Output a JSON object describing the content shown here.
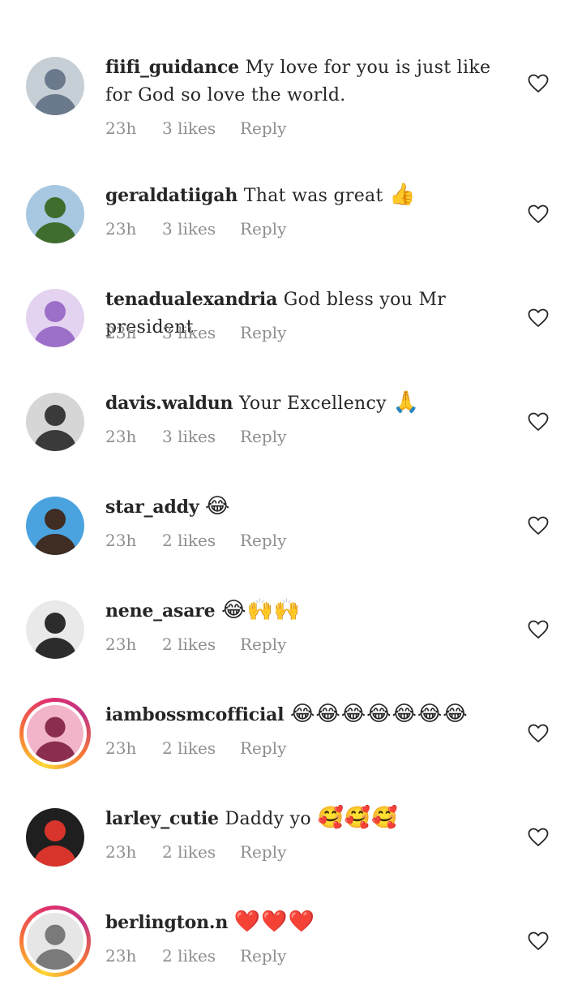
{
  "comments": [
    {
      "username": "fiifi_guidance",
      "text": "My love for you is just like for God so love the world.",
      "emoji": "",
      "time": "23h",
      "likes": "3 likes",
      "reply": "Reply",
      "story_ring": false,
      "avatar_colors": [
        "#6a7a8c",
        "#c7cfd6"
      ]
    },
    {
      "username": "geraldatiigah",
      "text": "That was great",
      "emoji": "👍",
      "time": "23h",
      "likes": "3 likes",
      "reply": "Reply",
      "story_ring": false,
      "avatar_colors": [
        "#3f6d2e",
        "#a8c7e0"
      ]
    },
    {
      "username": "tenadualexandria",
      "text": "God bless you Mr president",
      "emoji": "",
      "time": "23h",
      "likes": "3 likes",
      "reply": "Reply",
      "story_ring": false,
      "avatar_colors": [
        "#9c6fc9",
        "#e4d3f0"
      ]
    },
    {
      "username": "davis.waldun",
      "text": "Your Excellency",
      "emoji": "🙏",
      "time": "23h",
      "likes": "3 likes",
      "reply": "Reply",
      "story_ring": false,
      "avatar_colors": [
        "#3a3a3a",
        "#d6d6d6"
      ]
    },
    {
      "username": "star_addy",
      "text": "",
      "emoji": "😂",
      "time": "23h",
      "likes": "2 likes",
      "reply": "Reply",
      "story_ring": false,
      "avatar_colors": [
        "#3f2c22",
        "#4aa3df"
      ]
    },
    {
      "username": "nene_asare",
      "text": "",
      "emoji": "😂🙌🙌",
      "time": "23h",
      "likes": "2 likes",
      "reply": "Reply",
      "story_ring": false,
      "avatar_colors": [
        "#2c2c2c",
        "#e9e9e9"
      ]
    },
    {
      "username": "iambossmcofficial",
      "text": "",
      "emoji": "😂😂😂😂😂😂😂",
      "time": "23h",
      "likes": "2 likes",
      "reply": "Reply",
      "story_ring": true,
      "avatar_colors": [
        "#8a2d4f",
        "#f2b4c8"
      ]
    },
    {
      "username": "larley_cutie",
      "text": "Daddy yo",
      "emoji": "🥰🥰🥰",
      "time": "23h",
      "likes": "2 likes",
      "reply": "Reply",
      "story_ring": false,
      "avatar_colors": [
        "#d9342b",
        "#1f1f1f"
      ]
    },
    {
      "username": "berlington.n",
      "text": "",
      "emoji": "❤️❤️❤️",
      "time": "23h",
      "likes": "2 likes",
      "reply": "Reply",
      "story_ring": true,
      "avatar_colors": [
        "#7a7a7a",
        "#e6e6e6"
      ]
    }
  ],
  "theme": {
    "text_color": "#262626",
    "meta_color": "#8e8e8e",
    "heart_icon": "heart-outline-icon"
  }
}
